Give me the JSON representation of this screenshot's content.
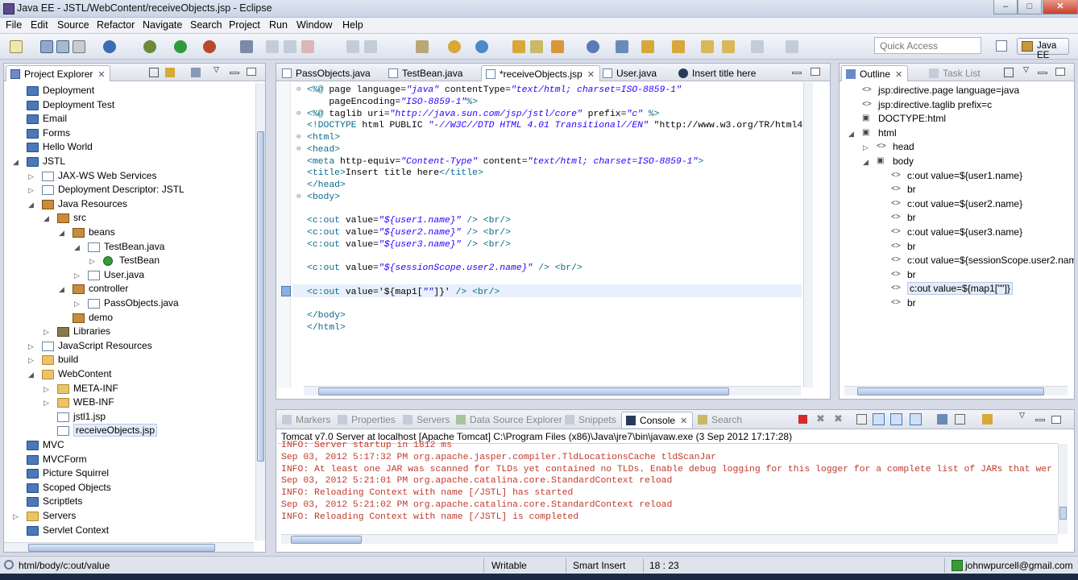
{
  "window": {
    "title": "Java EE - JSTL/WebContent/receiveObjects.jsp - Eclipse"
  },
  "menu": [
    "File",
    "Edit",
    "Source",
    "Refactor",
    "Navigate",
    "Search",
    "Project",
    "Run",
    "Window",
    "Help"
  ],
  "quick_access": {
    "placeholder": "Quick Access"
  },
  "perspective": {
    "label": "Java EE"
  },
  "project_explorer": {
    "title": "Project Explorer",
    "items": [
      {
        "label": "Deployment",
        "icon": "project-icon",
        "depth": 0,
        "arrow": ""
      },
      {
        "label": "Deployment Test",
        "icon": "project-icon",
        "depth": 0,
        "arrow": ""
      },
      {
        "label": "Email",
        "icon": "project-icon",
        "depth": 0,
        "arrow": ""
      },
      {
        "label": "Forms",
        "icon": "project-icon",
        "depth": 0,
        "arrow": ""
      },
      {
        "label": "Hello World",
        "icon": "project-icon",
        "depth": 0,
        "arrow": ""
      },
      {
        "label": "JSTL",
        "icon": "project-icon",
        "depth": 0,
        "arrow": "open"
      },
      {
        "label": "JAX-WS Web Services",
        "icon": "webservice-icon",
        "depth": 1,
        "arrow": "closed"
      },
      {
        "label": "Deployment Descriptor: JSTL",
        "icon": "descriptor-icon",
        "depth": 1,
        "arrow": "closed"
      },
      {
        "label": "Java Resources",
        "icon": "java-resources-icon",
        "depth": 1,
        "arrow": "open"
      },
      {
        "label": "src",
        "icon": "source-folder-icon",
        "depth": 2,
        "arrow": "open"
      },
      {
        "label": "beans",
        "icon": "package-icon",
        "depth": 3,
        "arrow": "open"
      },
      {
        "label": "TestBean.java",
        "icon": "java-file-icon",
        "depth": 4,
        "arrow": "open"
      },
      {
        "label": "TestBean",
        "icon": "class-icon",
        "depth": 5,
        "arrow": "closed"
      },
      {
        "label": "User.java",
        "icon": "java-file-icon",
        "depth": 4,
        "arrow": "closed"
      },
      {
        "label": "controller",
        "icon": "package-icon",
        "depth": 3,
        "arrow": "open"
      },
      {
        "label": "PassObjects.java",
        "icon": "java-file-icon",
        "depth": 4,
        "arrow": "closed"
      },
      {
        "label": "demo",
        "icon": "package-icon",
        "depth": 3,
        "arrow": ""
      },
      {
        "label": "Libraries",
        "icon": "library-icon",
        "depth": 2,
        "arrow": "closed"
      },
      {
        "label": "JavaScript Resources",
        "icon": "javascript-icon",
        "depth": 1,
        "arrow": "closed"
      },
      {
        "label": "build",
        "icon": "folder-icon",
        "depth": 1,
        "arrow": "closed"
      },
      {
        "label": "WebContent",
        "icon": "folder-icon",
        "depth": 1,
        "arrow": "open"
      },
      {
        "label": "META-INF",
        "icon": "folder-icon",
        "depth": 2,
        "arrow": "closed"
      },
      {
        "label": "WEB-INF",
        "icon": "folder-icon",
        "depth": 2,
        "arrow": "closed"
      },
      {
        "label": "jstl1.jsp",
        "icon": "jsp-file-icon",
        "depth": 2,
        "arrow": ""
      },
      {
        "label": "receiveObjects.jsp",
        "icon": "jsp-file-icon",
        "depth": 2,
        "arrow": "",
        "selected": true
      },
      {
        "label": "MVC",
        "icon": "project-icon",
        "depth": 0,
        "arrow": ""
      },
      {
        "label": "MVCForm",
        "icon": "project-icon",
        "depth": 0,
        "arrow": ""
      },
      {
        "label": "Picture Squirrel",
        "icon": "project-icon",
        "depth": 0,
        "arrow": ""
      },
      {
        "label": "Scoped Objects",
        "icon": "project-icon",
        "depth": 0,
        "arrow": ""
      },
      {
        "label": "Scriptlets",
        "icon": "project-icon",
        "depth": 0,
        "arrow": ""
      },
      {
        "label": "Servers",
        "icon": "folder-icon",
        "depth": 0,
        "arrow": "closed"
      },
      {
        "label": "Servlet Context",
        "icon": "project-icon",
        "depth": 0,
        "arrow": ""
      }
    ]
  },
  "editor": {
    "tabs": [
      {
        "label": "PassObjects.java",
        "active": false
      },
      {
        "label": "TestBean.java",
        "active": false
      },
      {
        "label": "*receiveObjects.jsp",
        "active": true
      },
      {
        "label": "User.java",
        "active": false
      },
      {
        "label": "Insert title here",
        "active": false
      }
    ],
    "lines": [
      "<%@ page language=\"java\" contentType=\"text/html; charset=ISO-8859-1\"",
      "    pageEncoding=\"ISO-8859-1\"%>",
      "<%@ taglib uri=\"http://java.sun.com/jsp/jstl/core\" prefix=\"c\" %>",
      "<!DOCTYPE html PUBLIC \"-//W3C//DTD HTML 4.01 Transitional//EN\" \"http://www.w3.org/TR/html4",
      "<html>",
      "<head>",
      "<meta http-equiv=\"Content-Type\" content=\"text/html; charset=ISO-8859-1\">",
      "<title>Insert title here</title>",
      "</head>",
      "<body>",
      "",
      "<c:out value=\"${user1.name}\" /> <br/>",
      "<c:out value=\"${user2.name}\" /> <br/>",
      "<c:out value=\"${user3.name}\" /> <br/>",
      "",
      "<c:out value=\"${sessionScope.user2.name}\" /> <br/>",
      "",
      "<c:out value='${map1[\"\"]}' /> <br/>",
      "",
      "</body>",
      "</html>"
    ]
  },
  "outline": {
    "tabs": [
      "Outline",
      "Task List"
    ],
    "items": [
      {
        "label": "jsp:directive.page language=java",
        "depth": 0,
        "arrow": ""
      },
      {
        "label": "jsp:directive.taglib prefix=c",
        "depth": 0,
        "arrow": ""
      },
      {
        "label": "DOCTYPE:html",
        "depth": 0,
        "arrow": ""
      },
      {
        "label": "html",
        "depth": 0,
        "arrow": "open"
      },
      {
        "label": "head",
        "depth": 1,
        "arrow": "closed"
      },
      {
        "label": "body",
        "depth": 1,
        "arrow": "open"
      },
      {
        "label": "c:out value=${user1.name}",
        "depth": 2,
        "arrow": ""
      },
      {
        "label": "br",
        "depth": 2,
        "arrow": ""
      },
      {
        "label": "c:out value=${user2.name}",
        "depth": 2,
        "arrow": ""
      },
      {
        "label": "br",
        "depth": 2,
        "arrow": ""
      },
      {
        "label": "c:out value=${user3.name}",
        "depth": 2,
        "arrow": ""
      },
      {
        "label": "br",
        "depth": 2,
        "arrow": ""
      },
      {
        "label": "c:out value=${sessionScope.user2.nam",
        "depth": 2,
        "arrow": ""
      },
      {
        "label": "br",
        "depth": 2,
        "arrow": ""
      },
      {
        "label": "c:out value=${map1[\"\"]}",
        "depth": 2,
        "arrow": "",
        "selected": true
      },
      {
        "label": "br",
        "depth": 2,
        "arrow": ""
      }
    ]
  },
  "console": {
    "tabs": [
      "Markers",
      "Properties",
      "Servers",
      "Data Source Explorer",
      "Snippets",
      "Console",
      "Search"
    ],
    "header": "Tomcat v7.0 Server at localhost [Apache Tomcat] C:\\Program Files (x86)\\Java\\jre7\\bin\\javaw.exe (3 Sep 2012 17:17:28)",
    "lines": [
      "INFO: Server startup in 1812 ms",
      "Sep 03, 2012 5:17:32 PM org.apache.jasper.compiler.TldLocationsCache tldScanJar",
      "INFO: At least one JAR was scanned for TLDs yet contained no TLDs. Enable debug logging for this logger for a complete list of JARs that wer",
      "Sep 03, 2012 5:21:01 PM org.apache.catalina.core.StandardContext reload",
      "INFO: Reloading Context with name [/JSTL] has started",
      "Sep 03, 2012 5:21:02 PM org.apache.catalina.core.StandardContext reload",
      "INFO: Reloading Context with name [/JSTL] is completed"
    ]
  },
  "status": {
    "path": "html/body/c:out/value",
    "writable": "Writable",
    "insert_mode": "Smart Insert",
    "position": "18 : 23",
    "user": "johnwpurcell@gmail.com"
  },
  "colors": {
    "console_text": "#c0392b",
    "selection": "#cfe0f7",
    "accent": "#3b6db5"
  }
}
